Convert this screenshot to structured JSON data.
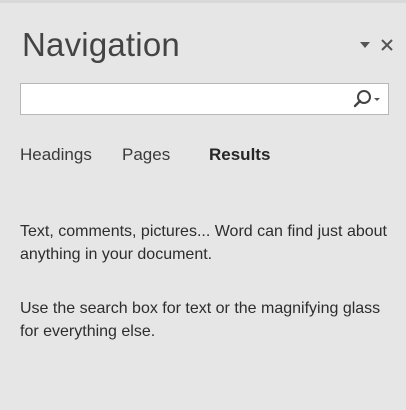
{
  "pane": {
    "title": "Navigation",
    "options_icon": "triangle-down-icon",
    "close_icon": "close-icon"
  },
  "search": {
    "value": "",
    "placeholder": "",
    "button_icon": "magnifier-icon"
  },
  "tabs": [
    {
      "label": "Headings",
      "active": false
    },
    {
      "label": "Pages",
      "active": false
    },
    {
      "label": "Results",
      "active": true
    }
  ],
  "results": {
    "message_1": "Text, comments, pictures... Word can find just about anything in your document.",
    "message_2": "Use the search box for text or the magnifying glass for everything else."
  },
  "colors": {
    "background": "#e6e6e6",
    "text": "#262626",
    "border": "#b7b7b7"
  }
}
